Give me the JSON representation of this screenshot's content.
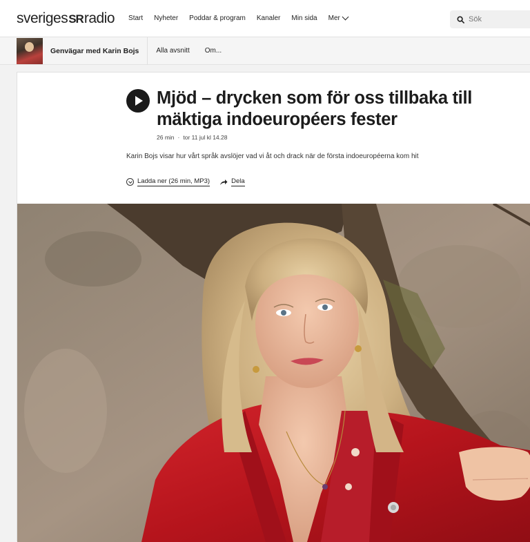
{
  "header": {
    "logo_left": "sveriges",
    "logo_mark": "SR",
    "logo_right": "radio",
    "nav": [
      "Start",
      "Nyheter",
      "Poddar & program",
      "Kanaler",
      "Min sida"
    ],
    "more_label": "Mer",
    "search_placeholder": "Sök"
  },
  "program": {
    "title": "Genvägar med Karin Bojs",
    "links": [
      "Alla avsnitt",
      "Om..."
    ]
  },
  "episode": {
    "title": "Mjöd – drycken som för oss tillbaka till mäktiga indoeuropéers fester",
    "duration": "26 min",
    "separator": "·",
    "date": "tor 11 jul kl 14.28",
    "description": "Karin Bojs visar hur vårt språk avslöjer vad vi åt och drack när de första indoeuropéerna kom hit",
    "download_label": "Ladda ner (26 min, MP3)",
    "share_label": "Dela"
  }
}
